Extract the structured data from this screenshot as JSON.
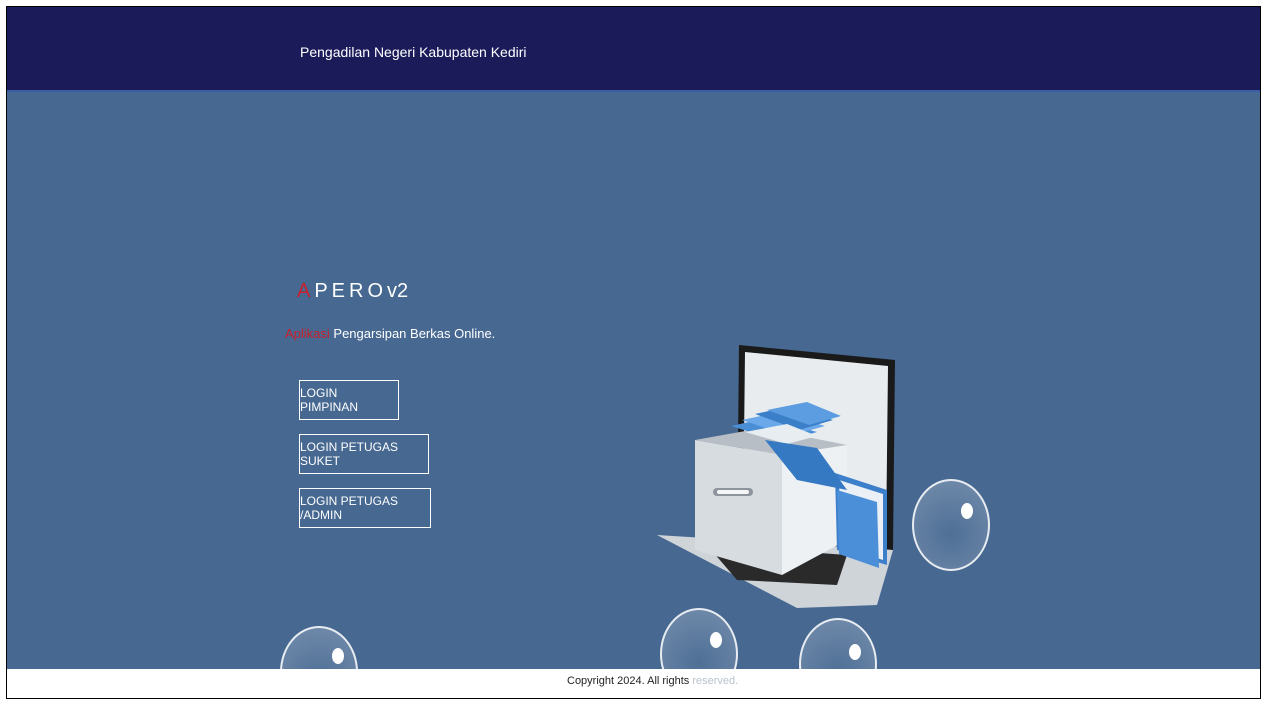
{
  "header": {
    "site_title": "Pengadilan Negeri Kabupaten Kediri"
  },
  "hero": {
    "app_title_first": "A",
    "app_title_rest": "PERO",
    "app_title_version": "v2",
    "tagline_highlight": "Aplikasi",
    "tagline_rest": " Pengarsipan Berkas Online."
  },
  "buttons": {
    "login_pimpinan": "LOGIN PIMPINAN",
    "login_petugas_suket": "LOGIN PETUGAS SUKET",
    "login_petugas_admin": "LOGIN PETUGAS /ADMIN"
  },
  "footer": {
    "copyright": "Copyright 2024. All rights",
    "copyright_faded": " reserved."
  },
  "colors": {
    "header_bg": "#1b1b5a",
    "main_bg": "#466891",
    "accent_red": "#c8202c"
  },
  "icons": {
    "illustration": "filing-cabinet-laptop-illustration"
  }
}
